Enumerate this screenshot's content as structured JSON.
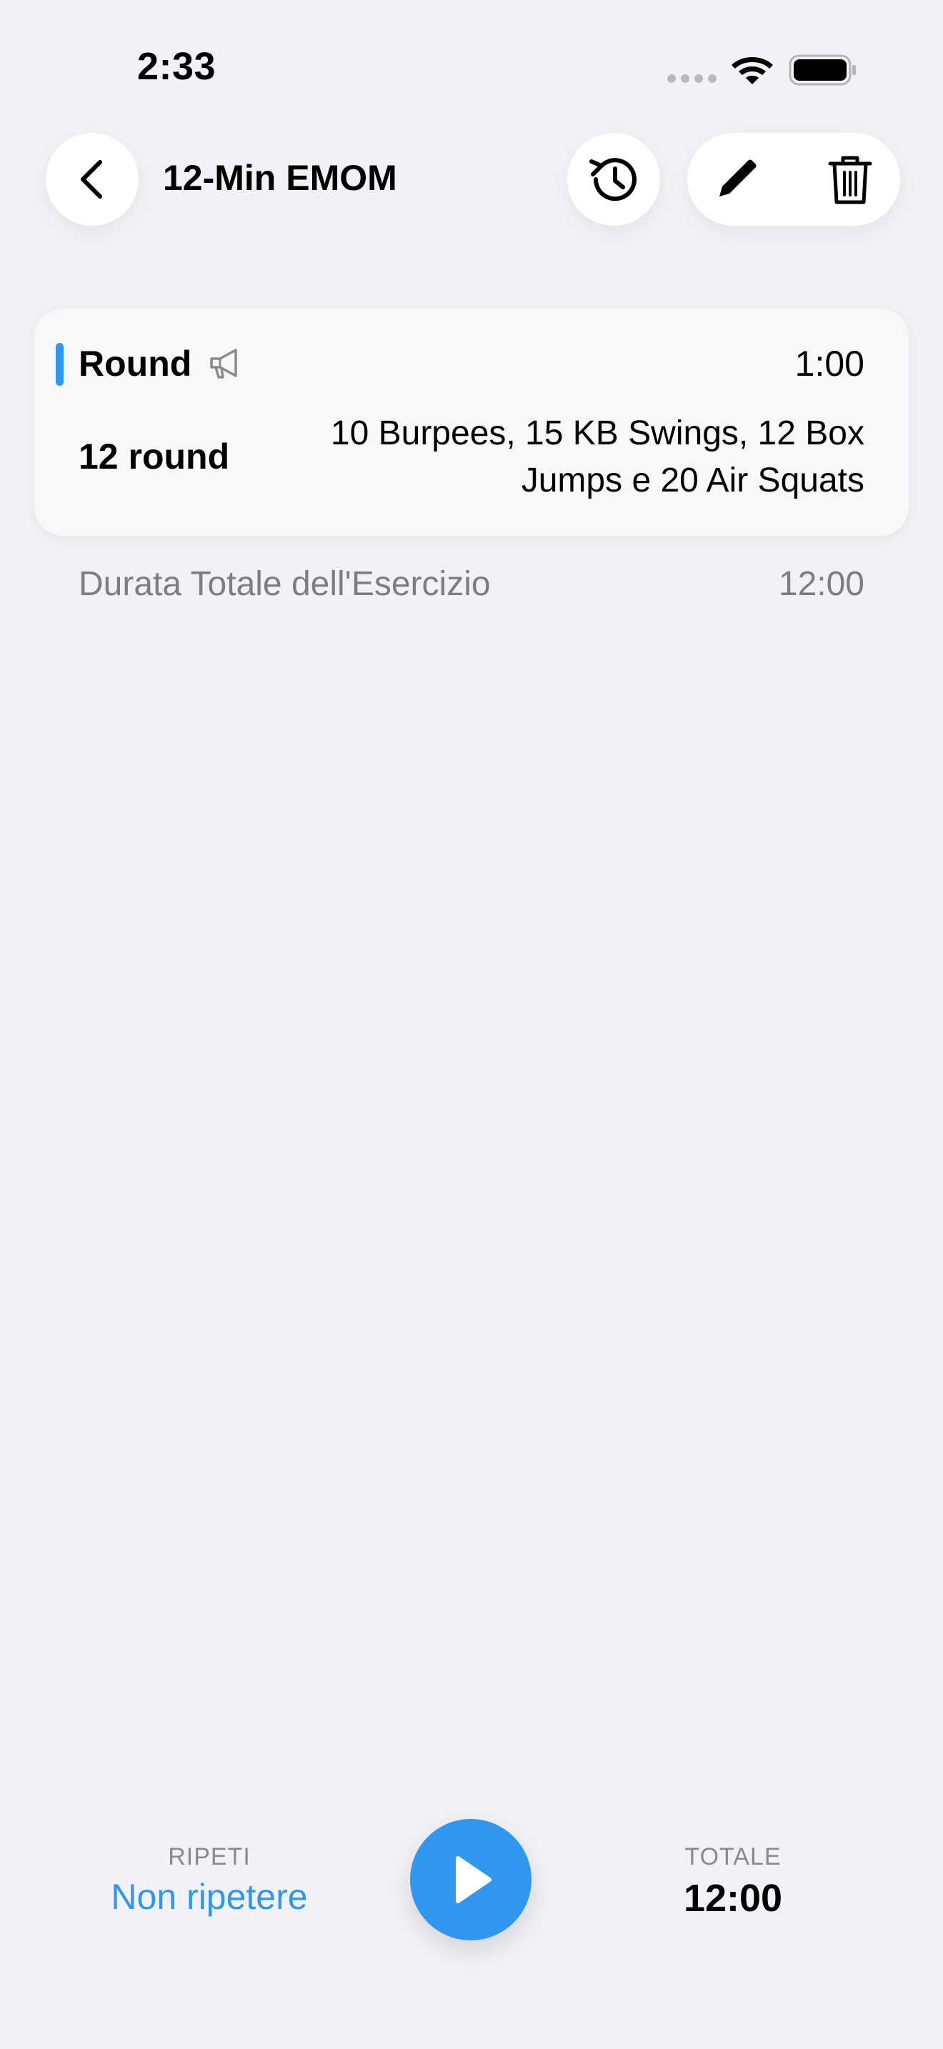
{
  "status_bar": {
    "time": "2:33"
  },
  "header": {
    "title": "12-Min EMOM",
    "icons": {
      "back": "chevron-left-icon",
      "history": "history-icon",
      "edit": "pencil-icon",
      "delete": "trash-icon"
    }
  },
  "card": {
    "accent_color": "#2f97ee",
    "round_label": "Round",
    "round_time": "1:00",
    "rounds_count": "12 round",
    "exercise_description": "10 Burpees, 15 KB Swings, 12 Box Jumps e 20 Air Squats"
  },
  "summary": {
    "total_label": "Durata Totale dell'Esercizio",
    "total_value": "12:00"
  },
  "bottom_bar": {
    "repeat_caption": "RIPETI",
    "repeat_value": "Non ripetere",
    "total_caption": "TOTALE",
    "total_value": "12:00",
    "accent_color": "#2f97ee"
  }
}
